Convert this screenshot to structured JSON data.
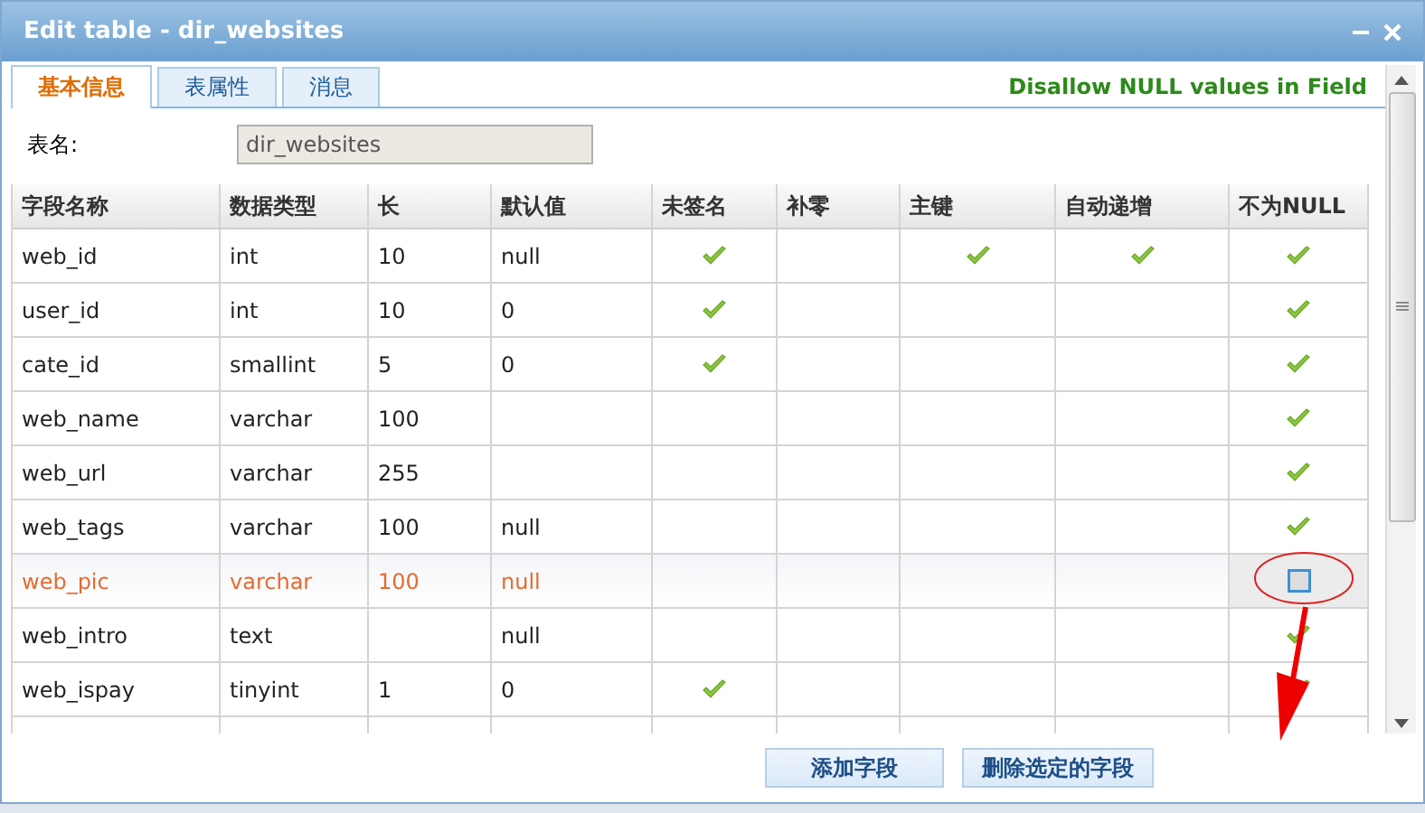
{
  "window": {
    "title": "Edit table - dir_websites"
  },
  "tabs": [
    {
      "label": "基本信息",
      "selected": true
    },
    {
      "label": "表属性",
      "selected": false
    },
    {
      "label": "消息",
      "selected": false
    }
  ],
  "hint": "Disallow NULL values in Field",
  "table_name": {
    "label": "表名:",
    "value": "dir_websites"
  },
  "table": {
    "columns": [
      "字段名称",
      "数据类型",
      "长",
      "默认值",
      "未签名",
      "补零",
      "主键",
      "自动递增",
      "不为NULL"
    ],
    "rows": [
      {
        "name": "web_id",
        "type": "int",
        "length": "10",
        "default": "null",
        "unsigned": true,
        "zerofill": false,
        "primary": true,
        "auto_increment": true,
        "not_null": true,
        "selected": false
      },
      {
        "name": "user_id",
        "type": "int",
        "length": "10",
        "default": "0",
        "unsigned": true,
        "zerofill": false,
        "primary": false,
        "auto_increment": false,
        "not_null": true,
        "selected": false
      },
      {
        "name": "cate_id",
        "type": "smallint",
        "length": "5",
        "default": "0",
        "unsigned": true,
        "zerofill": false,
        "primary": false,
        "auto_increment": false,
        "not_null": true,
        "selected": false
      },
      {
        "name": "web_name",
        "type": "varchar",
        "length": "100",
        "unsigned": false,
        "zerofill": false,
        "primary": false,
        "auto_increment": false,
        "not_null": true,
        "selected": false
      },
      {
        "name": "web_url",
        "type": "varchar",
        "length": "255",
        "unsigned": false,
        "zerofill": false,
        "primary": false,
        "auto_increment": false,
        "not_null": true,
        "selected": false
      },
      {
        "name": "web_tags",
        "type": "varchar",
        "length": "100",
        "default": "null",
        "unsigned": false,
        "zerofill": false,
        "primary": false,
        "auto_increment": false,
        "not_null": true,
        "selected": false
      },
      {
        "name": "web_pic",
        "type": "varchar",
        "length": "100",
        "default": "null",
        "unsigned": false,
        "zerofill": false,
        "primary": false,
        "auto_increment": false,
        "not_null": false,
        "selected": true
      },
      {
        "name": "web_intro",
        "type": "text",
        "default": "null",
        "unsigned": false,
        "zerofill": false,
        "primary": false,
        "auto_increment": false,
        "not_null": true,
        "selected": false
      },
      {
        "name": "web_ispay",
        "type": "tinyint",
        "length": "1",
        "default": "0",
        "unsigned": true,
        "zerofill": false,
        "primary": false,
        "auto_increment": false,
        "not_null": true,
        "selected": false
      }
    ]
  },
  "buttons": [
    "添加字段",
    "删除选定的字段"
  ]
}
